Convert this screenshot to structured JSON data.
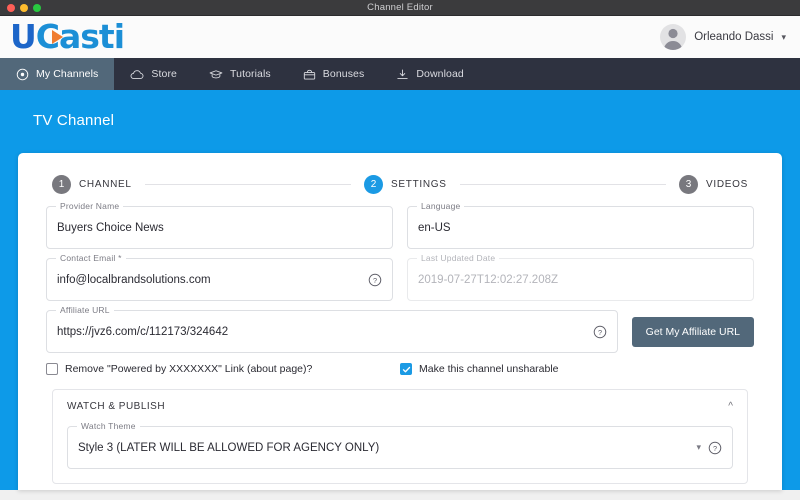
{
  "window": {
    "title": "Channel Editor",
    "controls": [
      "close",
      "minimize",
      "zoom"
    ]
  },
  "brand": {
    "logo_first": "U",
    "logo_rest": "Casti",
    "play_icon": "play-triangle-icon"
  },
  "account": {
    "name": "Orleando Dassi",
    "avatar_icon": "user-avatar-icon",
    "chevron": "⌄"
  },
  "nav": {
    "items": [
      {
        "label": "My Channels",
        "icon": "record-circle-icon",
        "active": true
      },
      {
        "label": "Store",
        "icon": "cloud-icon",
        "active": false
      },
      {
        "label": "Tutorials",
        "icon": "graduation-cap-icon",
        "active": false
      },
      {
        "label": "Bonuses",
        "icon": "gift-box-icon",
        "active": false
      },
      {
        "label": "Download",
        "icon": "download-icon",
        "active": false
      }
    ]
  },
  "banner": {
    "title": "TV Channel"
  },
  "stepper": {
    "steps": [
      {
        "num": "1",
        "label": "CHANNEL",
        "active": false
      },
      {
        "num": "2",
        "label": "SETTINGS",
        "active": true
      },
      {
        "num": "3",
        "label": "VIDEOS",
        "active": false
      }
    ]
  },
  "form": {
    "provider_name": {
      "label": "Provider Name",
      "value": "Buyers Choice News"
    },
    "language": {
      "label": "Language",
      "value": "en-US"
    },
    "contact_email": {
      "label": "Contact Email *",
      "value": "info@localbrandsolutions.com",
      "help": "help-circle-icon"
    },
    "last_updated": {
      "label": "Last Updated Date",
      "value": "2019-07-27T12:02:27.208Z"
    },
    "affiliate_url": {
      "label": "Affiliate URL",
      "value": "https://jvz6.com/c/112173/324642",
      "help": "help-circle-icon"
    },
    "affiliate_button": "Get My Affiliate URL",
    "remove_powered_by": {
      "label": "Remove \"Powered by XXXXXXX\" Link (about page)?",
      "checked": false
    },
    "unsharable": {
      "label": "Make this channel unsharable",
      "checked": true
    }
  },
  "watch_publish": {
    "title": "WATCH & PUBLISH",
    "collapse_icon": "chevron-up-icon",
    "watch_theme": {
      "label": "Watch Theme",
      "value": "Style 3 (LATER WILL BE ALLOWED FOR AGENCY ONLY)",
      "caret": "▾",
      "help": "help-circle-icon"
    }
  },
  "colors": {
    "accent_blue": "#0d9ae8",
    "nav_dark": "#2e3240",
    "nav_active": "#52687a",
    "logo_blue": "#1d66c9",
    "logo_light_blue": "#1c8fd6",
    "play_orange": "#f07c30",
    "step_gray": "#78787e"
  }
}
